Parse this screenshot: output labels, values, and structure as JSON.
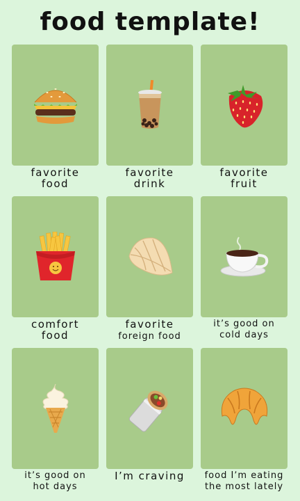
{
  "title": "food template!",
  "cards": [
    {
      "line1": "favorite",
      "line2": "food",
      "icon": "hamburger-icon"
    },
    {
      "line1": "favorite",
      "line2": "drink",
      "icon": "bubble-tea-icon"
    },
    {
      "line1": "favorite",
      "line2": "fruit",
      "icon": "strawberry-icon"
    },
    {
      "line1": "comfort",
      "line2": "food",
      "icon": "french-fries-icon"
    },
    {
      "line1": "favorite",
      "line2": "foreign  food",
      "icon": "dumpling-icon"
    },
    {
      "line1": "itʼs good on",
      "line2": "cold days",
      "icon": "hot-beverage-icon"
    },
    {
      "line1": "itʼs good on",
      "line2": "hot days",
      "icon": "soft-ice-cream-icon"
    },
    {
      "line1": "Iʼm craving",
      "line2": "",
      "icon": "burrito-icon"
    },
    {
      "line1": "food Iʼm eating",
      "line2": "the most lately",
      "icon": "croissant-icon"
    }
  ],
  "colors": {
    "background": "#dcf5dc",
    "card": "#a8cb8a",
    "text": "#111111"
  }
}
